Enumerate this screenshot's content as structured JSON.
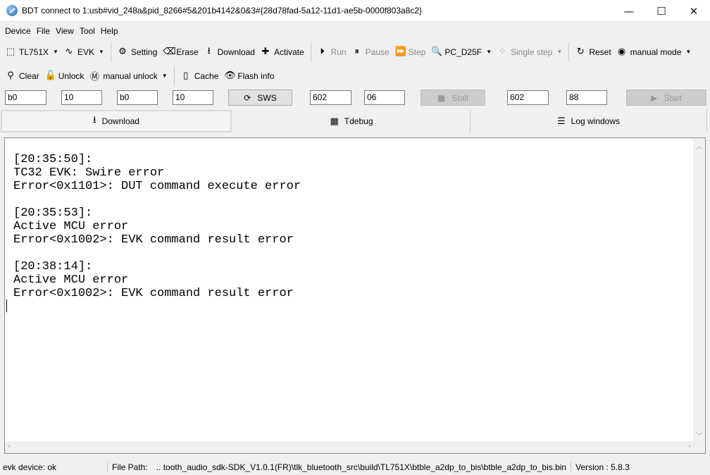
{
  "window": {
    "title": "BDT connect to 1:usb#vid_248a&pid_8266#5&201b4142&0&3#{28d78fad-5a12-11d1-ae5b-0000f803a8c2}",
    "minimize": "—",
    "maximize": "☐",
    "close": "✕"
  },
  "menu": [
    "Device",
    "File",
    "View",
    "Tool",
    "Help"
  ],
  "toolbar1": {
    "chip": "TL751X",
    "evk": "EVK",
    "setting": "Setting",
    "erase": "Erase",
    "download": "Download",
    "activate": "Activate",
    "run": "Run",
    "pause": "Pause",
    "step": "Step",
    "pc": "PC_D25F",
    "single_step": "Single step",
    "reset": "Reset",
    "manual_mode": "manual mode"
  },
  "toolbar2": {
    "clear": "Clear",
    "unlock": "Unlock",
    "manual_unlock": "manual unlock",
    "cache": "Cache",
    "flash_info": "Flash info"
  },
  "inputs": {
    "f1": "b0",
    "f2": "10",
    "f3": "b0",
    "f4": "10",
    "sws": "SWS",
    "f5": "602",
    "f6": "06",
    "stall": "Stall",
    "f7": "602",
    "f8": "88",
    "start": "Start"
  },
  "tabs": {
    "download": "Download",
    "tdebug": "Tdebug",
    "log_windows": "Log windows"
  },
  "log": "[20:35:50]:\nTC32 EVK: Swire error\nError<0x1101>: DUT command execute error\n\n[20:35:53]:\nActive MCU error\nError<0x1002>: EVK command result error\n\n[20:38:14]:\nActive MCU error\nError<0x1002>: EVK command result error",
  "status": {
    "device": "evk device: ok",
    "file_label": "File Path:",
    "file_path": "..  tooth_audio_sdk-SDK_V1.0.1(FR)\\tlk_bluetooth_src\\build\\TL751X\\btble_a2dp_to_bis\\btble_a2dp_to_bis.bin",
    "version": "Version : 5.8.3"
  },
  "colors": {
    "background": "#f0f0f0",
    "disabled_text": "#8a8a8a"
  }
}
